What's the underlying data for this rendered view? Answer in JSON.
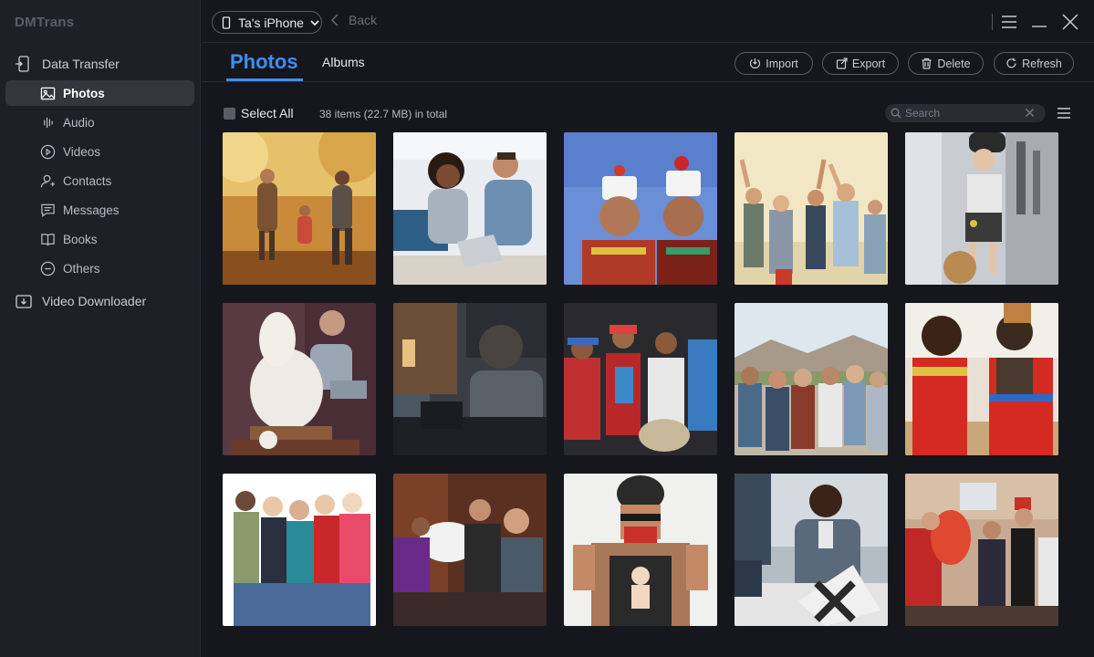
{
  "app": {
    "brand": "DMTrans"
  },
  "sidebar": {
    "data_transfer": "Data Transfer",
    "items": [
      {
        "label": "Photos",
        "icon": "photo-icon",
        "active": true
      },
      {
        "label": "Audio",
        "icon": "audio-icon"
      },
      {
        "label": "Videos",
        "icon": "video-icon"
      },
      {
        "label": "Contacts",
        "icon": "contacts-icon"
      },
      {
        "label": "Messages",
        "icon": "messages-icon"
      },
      {
        "label": "Books",
        "icon": "book-icon"
      },
      {
        "label": "Others",
        "icon": "others-icon"
      }
    ],
    "video_downloader": "Video Downloader"
  },
  "header": {
    "device": "Ta's iPhone",
    "back": "Back"
  },
  "tabs": {
    "photos": "Photos",
    "albums": "Albums"
  },
  "toolbar": {
    "import": "Import",
    "export": "Export",
    "delete": "Delete",
    "refresh": "Refresh"
  },
  "content": {
    "select_all": "Select All",
    "count": "38 items (22.7 MB) in total",
    "search_placeholder": "Search"
  },
  "colors": {
    "accent": "#3e8ef7",
    "background": "#16171c",
    "sidebar": "#1e2027"
  }
}
